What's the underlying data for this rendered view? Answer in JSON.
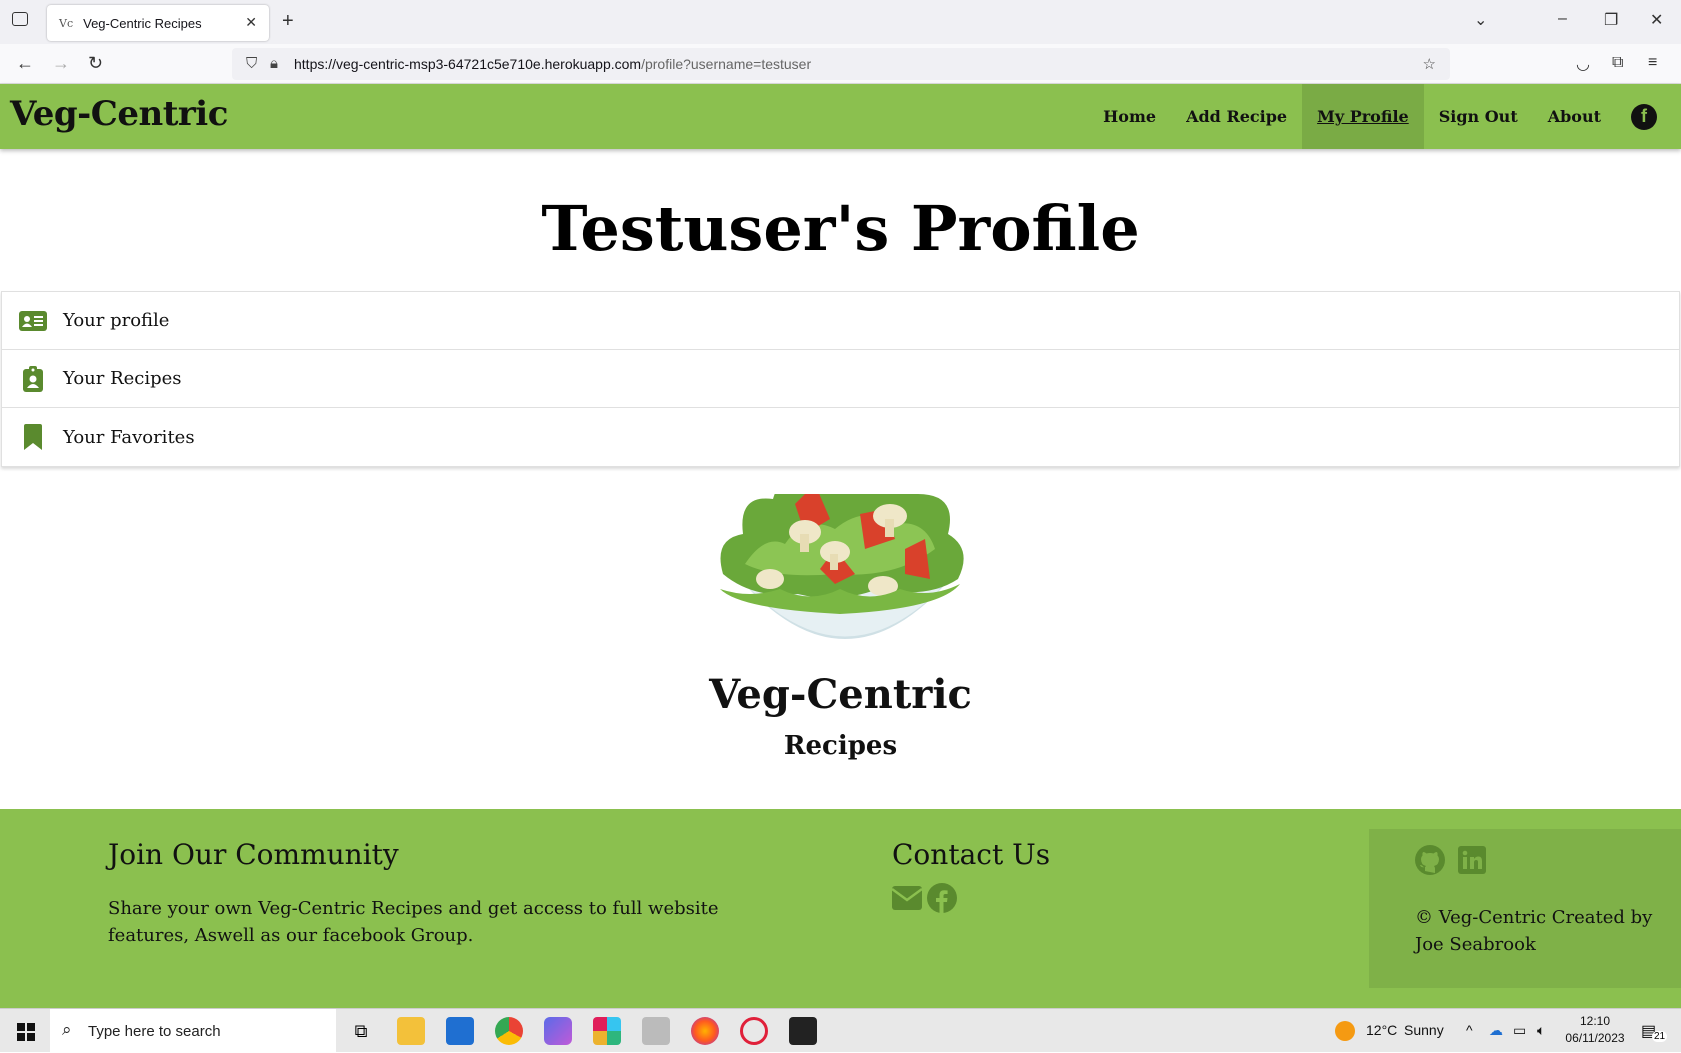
{
  "browser": {
    "tab_title": "Veg-Centric Recipes",
    "tab_favicon": "Vc",
    "url_host": "https://veg-centric-msp3-64721c5e710e.herokuapp.com",
    "url_path": "/profile?username=testuser"
  },
  "site": {
    "brand": "Veg-Centric",
    "nav": [
      "Home",
      "Add Recipe",
      "My Profile",
      "Sign Out",
      "About"
    ],
    "active_nav": "My Profile",
    "accent": "#8bc04f",
    "icon_color": "#5a8a2e"
  },
  "main": {
    "title": "Testuser's Profile",
    "items": [
      {
        "label": "Your profile",
        "icon": "id-card-icon"
      },
      {
        "label": "Your Recipes",
        "icon": "clipboard-user-icon"
      },
      {
        "label": "Your Favorites",
        "icon": "bookmark-icon"
      }
    ],
    "logo_title": "Veg-Centric",
    "logo_subtitle": "Recipes"
  },
  "footer": {
    "community_heading": "Join Our Community",
    "community_text_1": "Share your own Veg-Centric Recipes and get access to full website",
    "community_text_2": "features, Aswell as our facebook Group.",
    "contact_heading": "Contact Us",
    "copyright_1": "© Veg-Centric Created by",
    "copyright_2": "Joe Seabrook"
  },
  "taskbar": {
    "search_placeholder": "Type here to search",
    "weather_temp": "12°C",
    "weather_text": "Sunny",
    "time": "12:10",
    "date": "06/11/2023",
    "notifications": "21"
  }
}
